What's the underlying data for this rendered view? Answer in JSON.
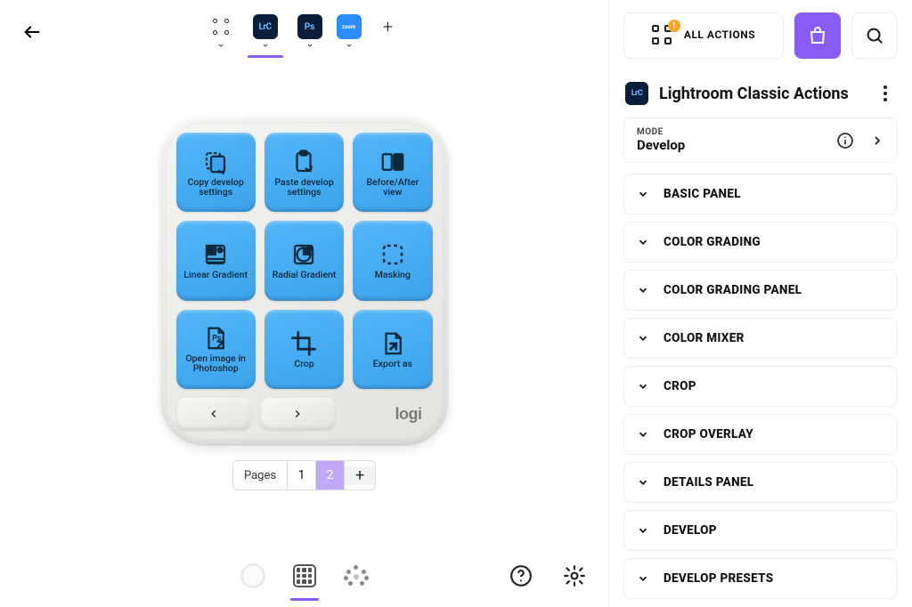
{
  "header": {
    "profiles": [
      {
        "id": "all",
        "type": "dots"
      },
      {
        "id": "lrc",
        "label": "LrC",
        "type": "lrc",
        "active": true
      },
      {
        "id": "ps",
        "label": "Ps",
        "type": "ps"
      },
      {
        "id": "zoom",
        "label": "zoom",
        "type": "zoom"
      }
    ]
  },
  "device": {
    "brand": "logi",
    "keys": [
      {
        "label": "Copy develop settings",
        "icon": "copy-settings"
      },
      {
        "label": "Paste develop settings",
        "icon": "paste-settings"
      },
      {
        "label": "Before/After view",
        "icon": "before-after"
      },
      {
        "label": "Linear Gradient",
        "icon": "linear-gradient"
      },
      {
        "label": "Radial Gradient",
        "icon": "radial-gradient"
      },
      {
        "label": "Masking",
        "icon": "masking"
      },
      {
        "label": "Open image in Photoshop",
        "icon": "open-ps"
      },
      {
        "label": "Crop",
        "icon": "crop"
      },
      {
        "label": "Export as",
        "icon": "export"
      }
    ]
  },
  "paginator": {
    "label": "Pages",
    "pages": [
      "1",
      "2"
    ],
    "active": "2"
  },
  "rightPanel": {
    "allActionsLabel": "ALL ACTIONS",
    "sectionTitle": "Lightroom Classic Actions",
    "mode": {
      "label": "MODE",
      "value": "Develop"
    },
    "groups": [
      "BASIC PANEL",
      "COLOR GRADING",
      "COLOR GRADING PANEL",
      "COLOR MIXER",
      "CROP",
      "CROP OVERLAY",
      "DETAILS PANEL",
      "DEVELOP",
      "DEVELOP PRESETS"
    ]
  }
}
